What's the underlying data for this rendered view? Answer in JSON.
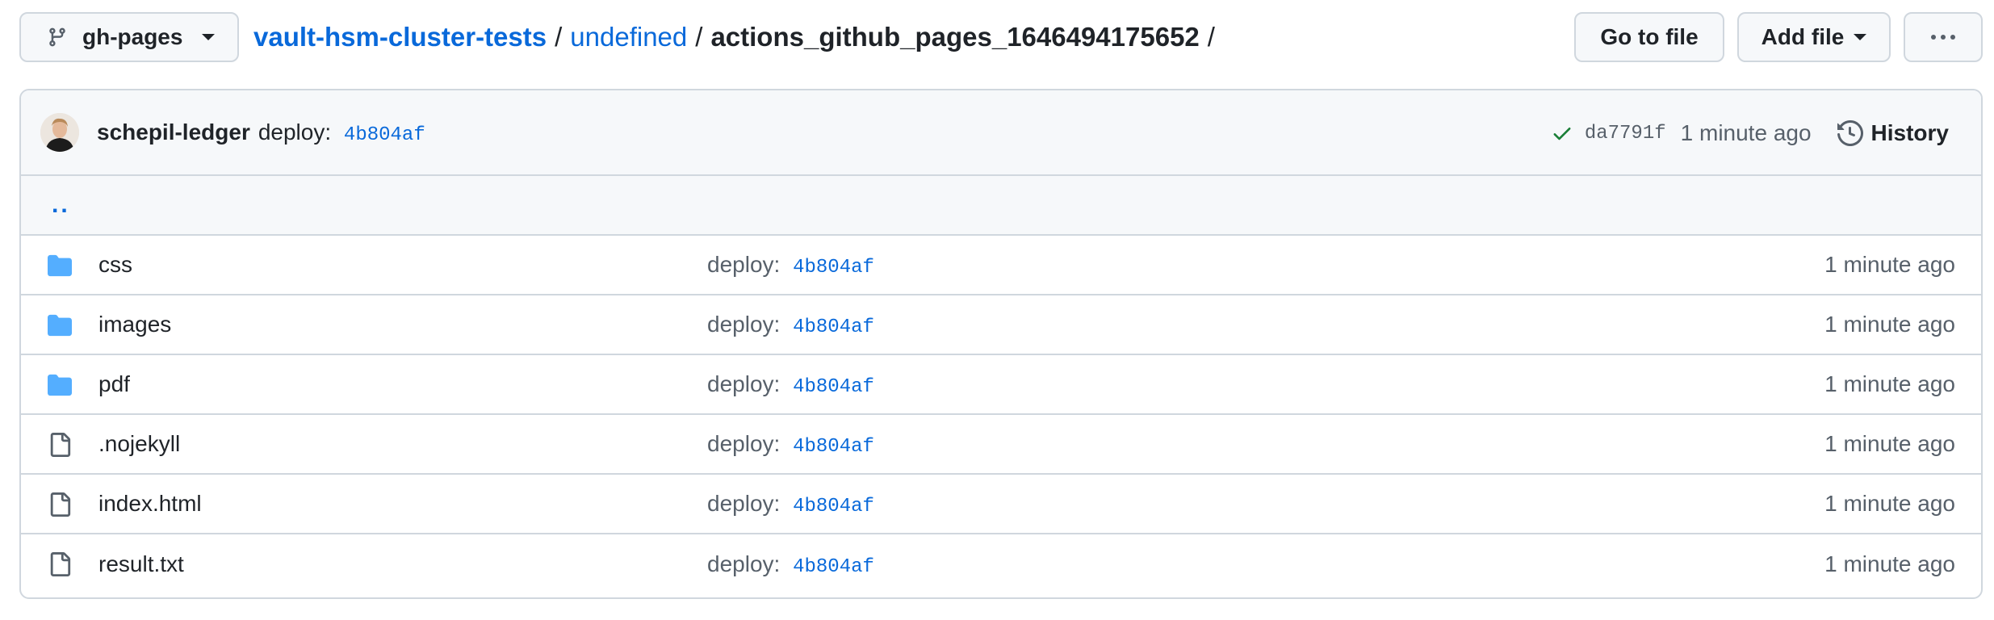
{
  "branch": {
    "label": "gh-pages",
    "icon": "git-branch-icon"
  },
  "breadcrumb": {
    "repo": "vault-hsm-cluster-tests",
    "sep1": "/",
    "folder": "undefined",
    "sep2": "/",
    "current": "actions_github_pages_1646494175652",
    "sep3": "/"
  },
  "actions": {
    "go_to_file": "Go to file",
    "add_file": "Add file"
  },
  "commit": {
    "author": "schepil-ledger",
    "message": "deploy:",
    "message_sha": "4b804af",
    "status": "success",
    "status_color": "#1a7f37",
    "sha": "da7791f",
    "time": "1 minute ago",
    "history_label": "History"
  },
  "parent": {
    "label": ".."
  },
  "files": [
    {
      "name": "css",
      "type": "folder",
      "message": "deploy:",
      "sha": "4b804af",
      "time": "1 minute ago"
    },
    {
      "name": "images",
      "type": "folder",
      "message": "deploy:",
      "sha": "4b804af",
      "time": "1 minute ago"
    },
    {
      "name": "pdf",
      "type": "folder",
      "message": "deploy:",
      "sha": "4b804af",
      "time": "1 minute ago"
    },
    {
      "name": ".nojekyll",
      "type": "file",
      "message": "deploy:",
      "sha": "4b804af",
      "time": "1 minute ago"
    },
    {
      "name": "index.html",
      "type": "file",
      "message": "deploy:",
      "sha": "4b804af",
      "time": "1 minute ago"
    },
    {
      "name": "result.txt",
      "type": "file",
      "message": "deploy:",
      "sha": "4b804af",
      "time": "1 minute ago"
    }
  ],
  "colors": {
    "link": "#0969da",
    "folder": "#54aeff",
    "border": "#d0d7de"
  }
}
